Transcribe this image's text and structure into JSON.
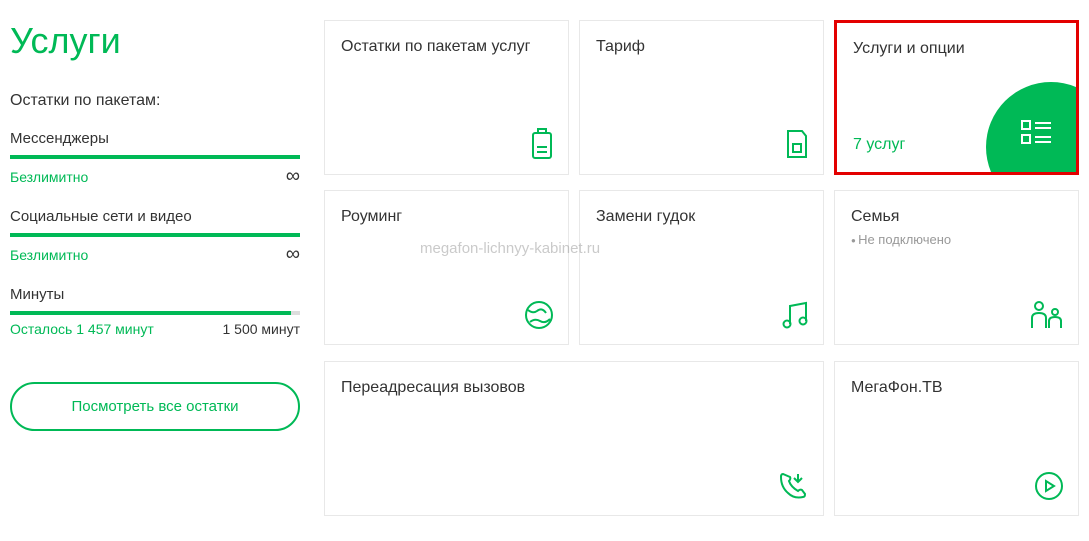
{
  "sidebar": {
    "title": "Услуги",
    "section_label": "Остатки по пакетам:",
    "balances": [
      {
        "name": "Мессенджеры",
        "status": "Безлимитно",
        "unlimited": true
      },
      {
        "name": "Социальные сети и видео",
        "status": "Безлимитно",
        "unlimited": true
      },
      {
        "name": "Минуты",
        "status": "Осталось 1 457 минут",
        "total": "1 500 минут",
        "unlimited": false
      }
    ],
    "view_all_label": "Посмотреть все остатки"
  },
  "cards": {
    "balance_packages": {
      "title": "Остатки по пакетам услуг"
    },
    "tariff": {
      "title": "Тариф"
    },
    "services_options": {
      "title": "Услуги и опции",
      "footer": "7 услуг"
    },
    "roaming": {
      "title": "Роуминг"
    },
    "replace_beep": {
      "title": "Замени гудок"
    },
    "family": {
      "title": "Семья",
      "subtitle": "Не подключено"
    },
    "call_forwarding": {
      "title": "Переадресация вызовов"
    },
    "megafon_tv": {
      "title": "МегаФон.ТВ"
    }
  },
  "watermark": "megafon-lichnyy-kabinet.ru"
}
